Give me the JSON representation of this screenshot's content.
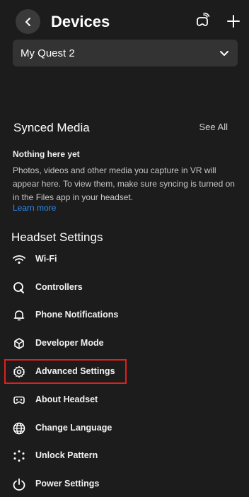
{
  "header": {
    "title": "Devices"
  },
  "device_select": {
    "selected": "My Quest 2"
  },
  "synced_media": {
    "title": "Synced Media",
    "see_all": "See All",
    "empty_title": "Nothing here yet",
    "empty_body": "Photos, videos and other media you capture in VR will appear here. To view them, make sure syncing is turned on in the Files app in your headset.",
    "learn_more": "Learn more"
  },
  "headset_settings": {
    "title": "Headset Settings",
    "items": [
      {
        "label": "Wi-Fi",
        "icon": "wifi-icon"
      },
      {
        "label": "Controllers",
        "icon": "controller-icon"
      },
      {
        "label": "Phone Notifications",
        "icon": "bell-icon"
      },
      {
        "label": "Developer Mode",
        "icon": "developer-icon"
      },
      {
        "label": "Advanced Settings",
        "icon": "gear-icon"
      },
      {
        "label": "About Headset",
        "icon": "headset-icon"
      },
      {
        "label": "Change Language",
        "icon": "globe-icon"
      },
      {
        "label": "Unlock Pattern",
        "icon": "pattern-dots-icon"
      },
      {
        "label": "Power Settings",
        "icon": "power-icon"
      }
    ]
  },
  "colors": {
    "background": "#1c1c1c",
    "link": "#2d8cf0",
    "highlight_border": "#e0201e"
  }
}
